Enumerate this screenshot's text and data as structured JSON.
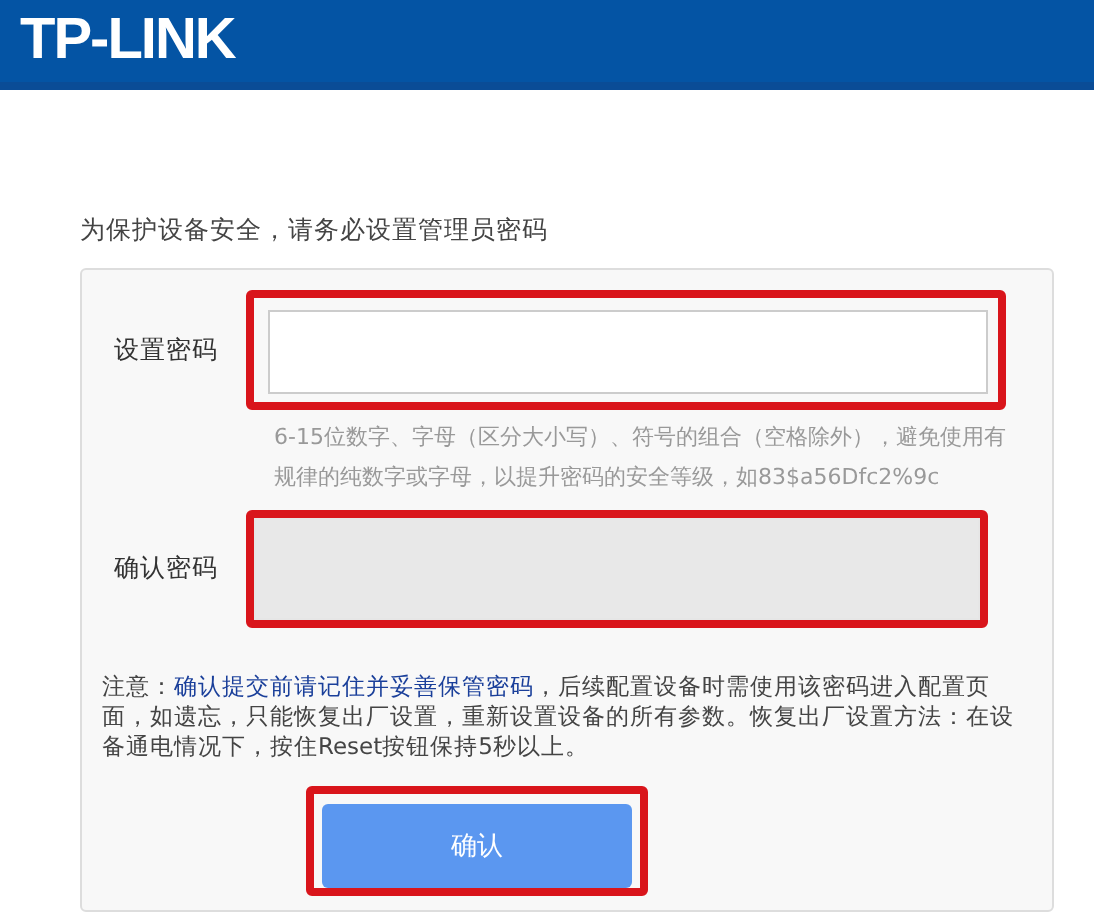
{
  "header": {
    "logo": "TP-LINK"
  },
  "intro": "为保护设备安全，请务必设置管理员密码",
  "fields": [
    {
      "label": "设置密码",
      "disabled": false,
      "highlighted": true,
      "hint": "6-15位数字、字母（区分大小写）、符号的组合（空格除外），避免使用有规律的纯数字或字母，以提升密码的安全等级，如83$a56Dfc2%9c"
    },
    {
      "label": "确认密码",
      "disabled": true,
      "highlighted": true
    }
  ],
  "notice": "注意：**确认提交前请记住并妥善保管密码**，后续配置设备时需使用该密码进入配置页面，如遗忘，只能恢复出厂设置，重新设置设备的所有参数。恢复出厂设置方法：在设备通电情况下，按住Reset按钮保持5秒以上。",
  "submit": {
    "label": "确认",
    "highlighted": true
  }
}
